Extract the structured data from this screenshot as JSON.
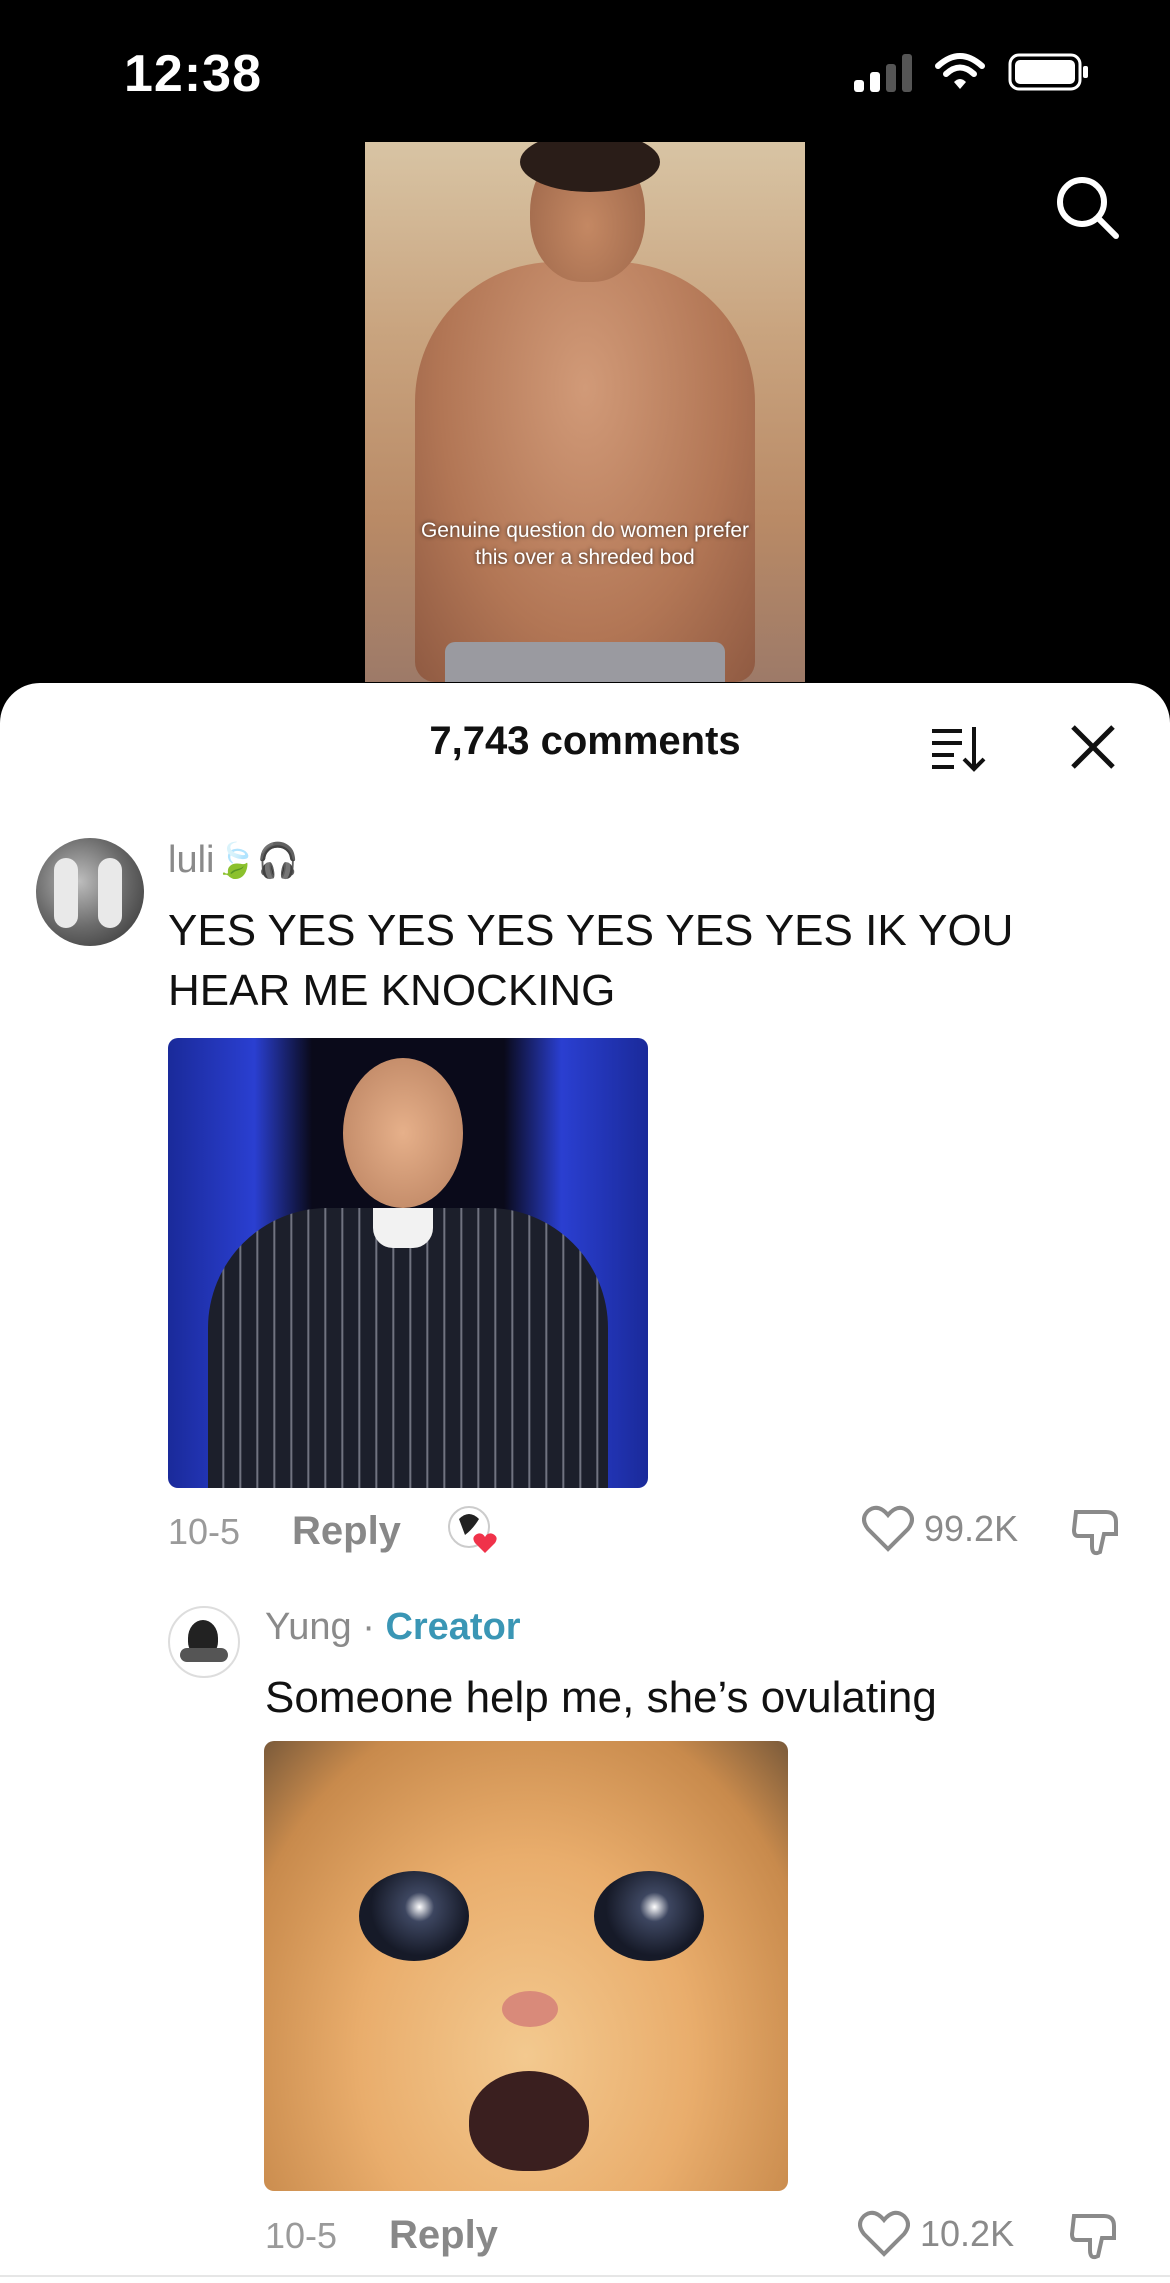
{
  "status_bar": {
    "time": "12:38"
  },
  "video": {
    "caption": "Genuine question do women prefer this over a shreded bod"
  },
  "comments_sheet": {
    "title": "7,743 comments",
    "comments": [
      {
        "username": "luli",
        "username_emoji": "🍃🎧",
        "text": "YES YES YES YES YES YES YES IK YOU HEAR ME KNOCKING",
        "date": "10-5",
        "reply_label": "Reply",
        "likes": "99.2K"
      }
    ],
    "replies": [
      {
        "username": "Yung",
        "separator": "·",
        "badge": "Creator",
        "text": "Someone help me, she’s ovulating",
        "date": "10-5",
        "reply_label": "Reply",
        "likes": "10.2K"
      }
    ]
  },
  "colors": {
    "creator_badge": "#3a96b5",
    "liked_heart": "#f0324a"
  },
  "icons": [
    "search-icon",
    "sort-icon",
    "close-icon",
    "heart-icon",
    "dislike-icon",
    "creator-liked-icon"
  ]
}
